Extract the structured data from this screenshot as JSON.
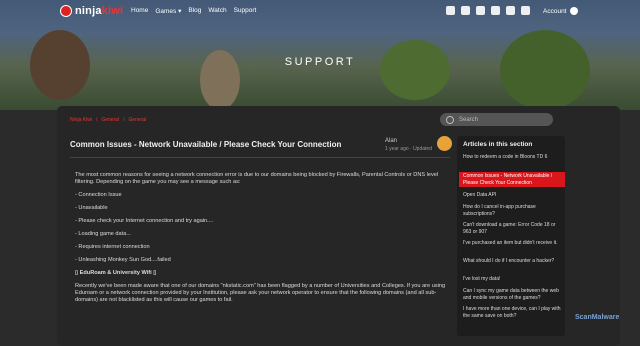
{
  "nav": {
    "logo_prefix": "ninja",
    "logo_suffix": "kiwi",
    "items": [
      "Home",
      "Games ▾",
      "Blog",
      "Watch",
      "Support"
    ],
    "account": "Account"
  },
  "hero": {
    "title": "SUPPORT"
  },
  "breadcrumb": [
    "Ninja Kiwi",
    "/",
    "General",
    "/",
    "General"
  ],
  "search": {
    "placeholder": "Search"
  },
  "article": {
    "title": "Common Issues - Network Unavailable / Please Check Your Connection",
    "author": "Alan",
    "meta": "1 year ago · Updated",
    "paragraphs": [
      "The most common reasons for seeing a network connection error is due to our domains being blocked by Firewalls, Parental Controls or DNS level filtering. Depending on the game you may see a message such as:",
      "- Connection Issue",
      "- Unavailable",
      "- Please check your Internet connection and try again....",
      "- Loading game data...",
      "- Requires internet connection",
      "- Unleashing Monkey Sun God....failed",
      "▯ EduRoam & University Wifi ▯",
      "Recently we've been made aware that one of our domains \"nkstatic.com\" has been flagged by a number of Universities and Colleges. If you are using Eduroam or a network connection provided by your Institution, please ask your network operator to ensure that the following domains (and all sub-domains) are not blacklisted as this will cause our games to fail."
    ]
  },
  "sidebar": {
    "title": "Articles in this section",
    "items": [
      "How to redeem a code in Bloons TD 6",
      "Common Issues - Network Unavailable / Please Check Your Connection",
      "Open Data API",
      "How do I cancel in-app purchase subscriptions?",
      "Can't download a game: Error Code 18 or 963 or 907",
      "I've purchased an item but didn't receive it.",
      "What should I do if I encounter a hacker?",
      "I've lost my data!",
      "Can I sync my game data between the web and mobile versions of the games?",
      "I have more than one device, can I play with the same save on both?"
    ]
  },
  "watermark": "ScanMalware"
}
